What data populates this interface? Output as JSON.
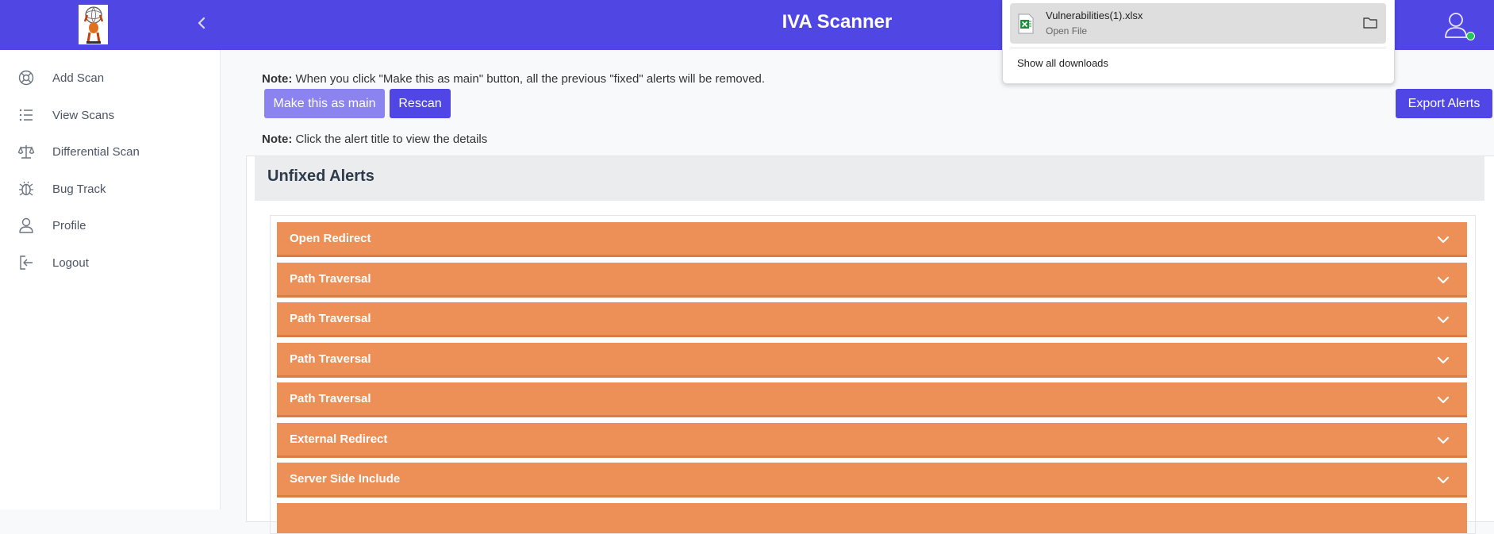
{
  "header": {
    "title": "IVA Scanner"
  },
  "sidebar": {
    "items": [
      {
        "label": "Add Scan",
        "icon": "add-scan-icon"
      },
      {
        "label": "View Scans",
        "icon": "list-icon"
      },
      {
        "label": "Differential Scan",
        "icon": "scale-icon"
      },
      {
        "label": "Bug Track",
        "icon": "bug-icon"
      },
      {
        "label": "Profile",
        "icon": "user-icon"
      },
      {
        "label": "Logout",
        "icon": "logout-icon"
      }
    ]
  },
  "main": {
    "note1": {
      "label": "Note:",
      "text": " When you click \"Make this as main\" button, all the previous \"fixed\" alerts will be removed."
    },
    "buttons": {
      "make_main": "Make this as main",
      "rescan": "Rescan",
      "export": "Export Alerts"
    },
    "note2": {
      "label": "Note:",
      "text": " Click the alert title to view the details"
    },
    "alerts_section": {
      "title": "Unfixed Alerts",
      "alerts": [
        "Open Redirect",
        "Path Traversal",
        "Path Traversal",
        "Path Traversal",
        "Path Traversal",
        "External Redirect",
        "Server Side Include"
      ]
    }
  },
  "downloads": {
    "file_name": "Vulnerabilities(1).xlsx",
    "file_action": "Open File",
    "show_all": "Show all downloads"
  },
  "colors": {
    "topbar": "#5046e4",
    "alert_row": "#ec9057",
    "primary_button": "#4f46e5",
    "light_button": "#8b84f0"
  }
}
